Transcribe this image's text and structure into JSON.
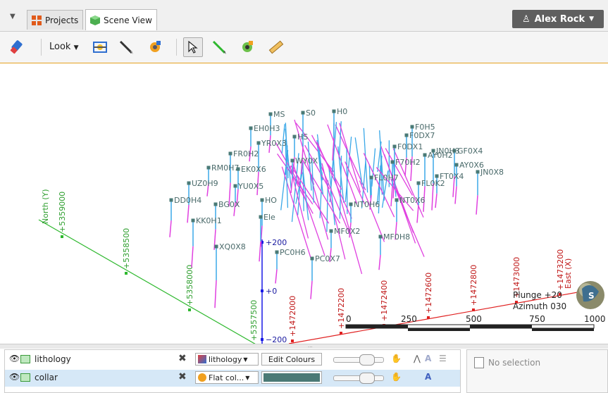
{
  "tabs": [
    {
      "label": "Projects",
      "icon": "projects-grid-icon"
    },
    {
      "label": "Scene View",
      "icon": "scene-cube-icon"
    }
  ],
  "user": {
    "name": "Alex Rock",
    "icon": "user-icon"
  },
  "toolbar": {
    "look_label": "Look"
  },
  "scene": {
    "holes": [
      "MS",
      "S0",
      "H0",
      "EH0H3",
      "YR0X3",
      "FR0H2",
      "RM0H7",
      "EK0X6",
      "WY0X",
      "UZ0H9",
      "YU0X5",
      "DD0H4",
      "BG0X",
      "KK0H1",
      "HO",
      "XQ0X8",
      "PC0H6",
      "PC0X7",
      "MF0X2",
      "MF0H8",
      "NT0H6",
      "NT0X6",
      "FL0H7",
      "FL0K2",
      "FT0X4",
      "JN0X8",
      "AY0X6",
      "AY0H2",
      "F70H2",
      "GF0X4",
      "JN0H3",
      "F0DX1",
      "F0DX7",
      "F0H5",
      "Ele",
      "HS"
    ],
    "north_label": "North (Y)",
    "north_ticks": [
      "+5359000",
      "+5358500",
      "+5358000",
      "+5357500"
    ],
    "east_label": "East (X)",
    "east_ticks": [
      "+1472000",
      "+1472200",
      "+1472400",
      "+1472600",
      "+1472800",
      "+1473000",
      "+1473200"
    ],
    "elev_ticks": [
      "+200",
      "+0",
      "−200"
    ],
    "scale_labels": [
      "0",
      "250",
      "500",
      "750",
      "1000"
    ],
    "plunge": "Plunge +20",
    "azimuth": "Azimuth 030"
  },
  "layers": [
    {
      "name": "lithology",
      "selector": "lithology",
      "button": "Edit Colours"
    },
    {
      "name": "collar",
      "selector": "Flat col...",
      "swatch": "#4a7a76"
    }
  ],
  "info_panel": {
    "text": "No selection"
  },
  "colors": {
    "accent": "#e5a11f",
    "north_axis": "#2eb82e",
    "east_axis": "#e02020",
    "elev_axis": "#1a1ae6",
    "trace_blue": "#3aa8e8",
    "trace_pink": "#e040e0"
  }
}
